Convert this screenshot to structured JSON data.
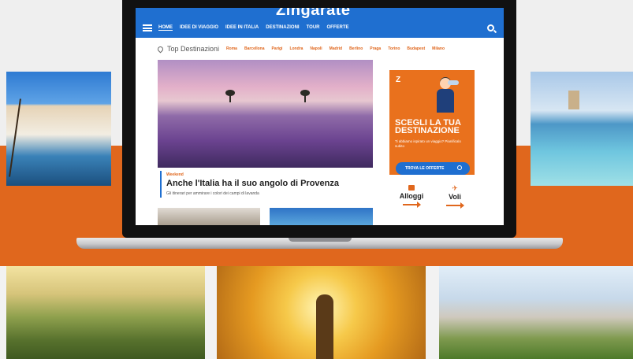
{
  "site": {
    "logo": "Zingarate"
  },
  "nav": {
    "items": [
      "HOME",
      "IDEE DI VIAGGIO",
      "IDEE IN ITALIA",
      "DESTINAZIONI",
      "TOUR",
      "OFFERTE"
    ],
    "active_index": 0
  },
  "top_destinations": {
    "title": "Top Destinazioni",
    "links": [
      "Roma",
      "Barcellona",
      "Parigi",
      "Londra",
      "Napoli",
      "Madrid",
      "Berlino",
      "Praga",
      "Torino",
      "Budapest",
      "Milano"
    ]
  },
  "article": {
    "tag": "Weekend",
    "title": "Anche l'Italia ha il suo angolo di Provenza",
    "subtitle": "Gli itinerari per ammirare i colori dei campi di lavanda"
  },
  "promo": {
    "logo": "Z",
    "title": "SCEGLI LA TUA DESTINAZIONE",
    "text": "Ti abbiamo ispirato un viaggio? Pianificalo subito",
    "button": "TROVA LE OFFERTE"
  },
  "services": [
    {
      "label": "Alloggi",
      "icon": "suitcase-icon"
    },
    {
      "label": "Voli",
      "icon": "plane-icon"
    }
  ],
  "colors": {
    "brand_orange": "#e0671d",
    "nav_blue": "#1f6fd0"
  }
}
